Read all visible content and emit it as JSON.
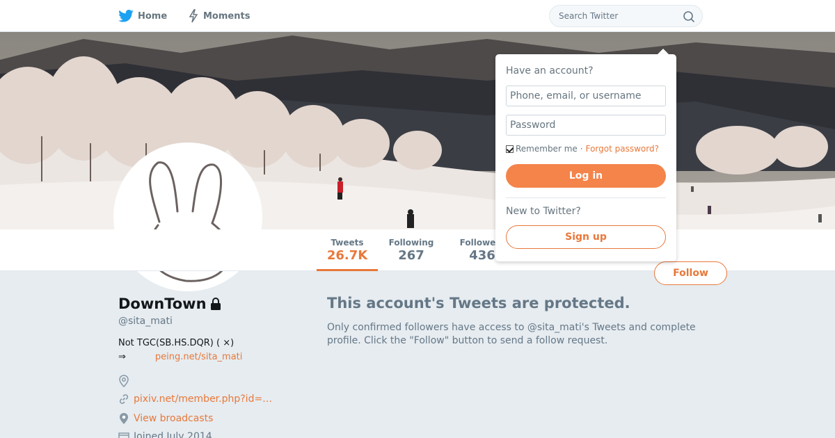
{
  "nav": {
    "home_label": "Home",
    "moments_label": "Moments"
  },
  "search": {
    "placeholder": "Search Twitter"
  },
  "profile": {
    "name": "DownTown",
    "handle": "@sita_mati",
    "bio_line1": "Not TGC(SB.HS.DQR) ( ×)",
    "bio_arrow": "⇒",
    "bio_link": "peing.net/sita_mati",
    "website": "pixiv.net/member.php?id=…",
    "broadcasts": "View broadcasts",
    "joined": "Joined July 2014"
  },
  "stats": [
    {
      "label": "Tweets",
      "value": "26.7K"
    },
    {
      "label": "Following",
      "value": "267"
    },
    {
      "label": "Followers",
      "value": "436"
    }
  ],
  "follow_label": "Follow",
  "protected": {
    "title": "This account's Tweets are protected.",
    "text": "Only confirmed followers have access to @sita_mati's Tweets and complete profile. Click the \"Follow\" button to send a follow request."
  },
  "login": {
    "heading": "Have an account?",
    "username_placeholder": "Phone, email, or username",
    "password_placeholder": "Password",
    "remember": "Remember me",
    "separator": "·",
    "forgot": "Forgot password?",
    "login_label": "Log in",
    "new_heading": "New to Twitter?",
    "signup_label": "Sign up"
  },
  "colors": {
    "accent": "#e8783a",
    "background": "#e6ecf0"
  }
}
